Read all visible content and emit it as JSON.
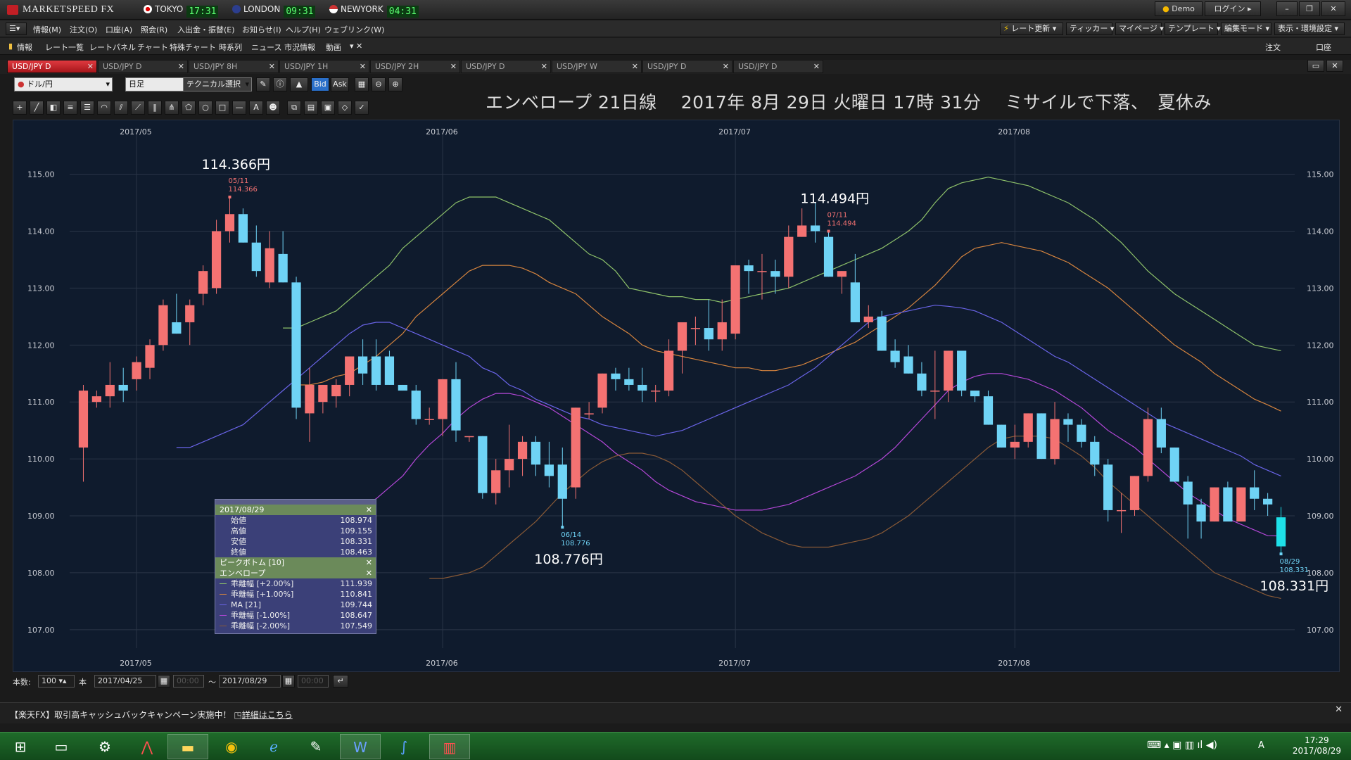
{
  "app": {
    "name": "MARKETSPEED FX"
  },
  "clocks": [
    {
      "city": "TOKYO",
      "time": "17:31"
    },
    {
      "city": "LONDON",
      "time": "09:31"
    },
    {
      "city": "NEWYORK",
      "time": "04:31"
    }
  ],
  "titlebar": {
    "demo_label": "Demo",
    "login_label": "ログイン"
  },
  "menu": [
    "情報(M)",
    "注文(O)",
    "口座(A)",
    "照会(R)",
    "入出金・振替(E)",
    "お知らせ(I)",
    "ヘルプ(H)",
    "ウェブリンク(W)"
  ],
  "menu_right": [
    "レート更新",
    "ティッカー",
    "マイページ",
    "テンプレート",
    "編集モード",
    "表示・環境設定"
  ],
  "quickbar": [
    "情報",
    "レート一覧",
    "レートパネル",
    "チャート",
    "特殊チャート",
    "時系列",
    "ニュース",
    "市況情報",
    "動画"
  ],
  "quickbar_right": [
    "注文",
    "口座"
  ],
  "tabs": [
    {
      "label": "USD/JPY D",
      "active": true
    },
    {
      "label": "USD/JPY D",
      "active": false
    },
    {
      "label": "USD/JPY 8H",
      "active": false
    },
    {
      "label": "USD/JPY 1H",
      "active": false
    },
    {
      "label": "USD/JPY 2H",
      "active": false
    },
    {
      "label": "USD/JPY D",
      "active": false
    },
    {
      "label": "USD/JPY W",
      "active": false
    },
    {
      "label": "USD/JPY D",
      "active": false
    },
    {
      "label": "USD/JPY D",
      "active": false
    }
  ],
  "chartbar": {
    "pair": "ドル/円",
    "period": "日足",
    "technical": "テクニカル選択",
    "bid": "Bid",
    "ask": "Ask"
  },
  "headline": "エンベロープ 21日線　 2017年 8月 29日 火曜日 17時 31分　 ミサイルで下落、　夏休み",
  "chart_data": {
    "type": "candlestick",
    "x_labels": [
      "2017/05",
      "2017/06",
      "2017/07",
      "2017/08"
    ],
    "x_label_index": [
      4,
      27,
      49,
      70
    ],
    "ylim": [
      106.8,
      115.7
    ],
    "yticks": [
      107.0,
      108.0,
      109.0,
      110.0,
      111.0,
      112.0,
      113.0,
      114.0,
      115.0
    ],
    "ohlc": [
      [
        110.2,
        111.3,
        109.6,
        111.2
      ],
      [
        111.0,
        111.2,
        110.9,
        111.1
      ],
      [
        111.1,
        111.7,
        110.9,
        111.3
      ],
      [
        111.3,
        111.6,
        111.0,
        111.2
      ],
      [
        111.4,
        111.8,
        111.2,
        111.7
      ],
      [
        111.6,
        112.1,
        111.4,
        112.0
      ],
      [
        112.0,
        112.8,
        111.9,
        112.7
      ],
      [
        112.4,
        112.9,
        112.2,
        112.2
      ],
      [
        112.4,
        112.8,
        112.0,
        112.7
      ],
      [
        112.9,
        113.4,
        112.7,
        113.3
      ],
      [
        113.0,
        114.2,
        112.9,
        114.0
      ],
      [
        114.0,
        114.6,
        113.8,
        114.3
      ],
      [
        114.3,
        114.4,
        113.8,
        113.8
      ],
      [
        113.8,
        114.1,
        113.2,
        113.3
      ],
      [
        113.1,
        114.0,
        113.0,
        113.7
      ],
      [
        113.6,
        114.0,
        113.1,
        113.1
      ],
      [
        113.1,
        113.2,
        110.7,
        110.9
      ],
      [
        110.8,
        111.6,
        110.3,
        111.3
      ],
      [
        111.0,
        111.3,
        110.8,
        111.3
      ],
      [
        111.1,
        111.4,
        110.9,
        111.3
      ],
      [
        111.3,
        111.8,
        111.1,
        111.8
      ],
      [
        111.8,
        112.1,
        111.3,
        111.5
      ],
      [
        111.8,
        112.1,
        111.2,
        111.3
      ],
      [
        111.8,
        111.9,
        111.3,
        111.3
      ],
      [
        111.3,
        111.3,
        111.2,
        111.2
      ],
      [
        111.2,
        111.3,
        110.6,
        110.7
      ],
      [
        110.7,
        110.9,
        110.6,
        110.7
      ],
      [
        110.7,
        111.4,
        110.4,
        111.4
      ],
      [
        111.4,
        111.7,
        110.3,
        110.5
      ],
      [
        110.4,
        110.4,
        110.3,
        110.4
      ],
      [
        110.4,
        110.4,
        109.3,
        109.4
      ],
      [
        109.4,
        110.0,
        109.2,
        109.8
      ],
      [
        109.8,
        110.6,
        109.5,
        110.0
      ],
      [
        110.0,
        110.4,
        109.7,
        110.3
      ],
      [
        110.3,
        110.4,
        109.7,
        109.9
      ],
      [
        109.9,
        110.3,
        109.5,
        109.7
      ],
      [
        109.9,
        110.2,
        108.8,
        109.3
      ],
      [
        109.5,
        110.9,
        109.3,
        110.9
      ],
      [
        110.8,
        111.0,
        110.7,
        110.8
      ],
      [
        110.9,
        111.5,
        110.8,
        111.5
      ],
      [
        111.5,
        111.6,
        111.2,
        111.4
      ],
      [
        111.4,
        111.6,
        111.2,
        111.3
      ],
      [
        111.3,
        111.6,
        111.0,
        111.2
      ],
      [
        111.2,
        111.3,
        111.0,
        111.2
      ],
      [
        111.2,
        112.1,
        111.1,
        111.9
      ],
      [
        111.9,
        112.3,
        111.5,
        112.4
      ],
      [
        112.3,
        112.5,
        112.0,
        112.3
      ],
      [
        112.3,
        112.8,
        111.9,
        112.1
      ],
      [
        112.1,
        112.8,
        111.9,
        112.4
      ],
      [
        112.2,
        113.4,
        112.1,
        113.4
      ],
      [
        113.4,
        113.5,
        112.9,
        113.3
      ],
      [
        113.3,
        113.6,
        112.8,
        113.3
      ],
      [
        113.3,
        113.5,
        112.9,
        113.2
      ],
      [
        113.2,
        114.1,
        113.0,
        113.9
      ],
      [
        113.9,
        114.4,
        113.9,
        114.1
      ],
      [
        114.1,
        114.5,
        113.8,
        114.0
      ],
      [
        113.9,
        114.0,
        113.2,
        113.2
      ],
      [
        113.2,
        113.3,
        112.9,
        113.3
      ],
      [
        113.1,
        113.6,
        112.4,
        112.4
      ],
      [
        112.4,
        112.7,
        112.3,
        112.5
      ],
      [
        112.5,
        112.6,
        111.9,
        111.9
      ],
      [
        111.9,
        112.1,
        111.6,
        111.7
      ],
      [
        111.8,
        112.0,
        111.5,
        111.5
      ],
      [
        111.5,
        111.7,
        111.1,
        111.2
      ],
      [
        111.2,
        111.9,
        110.7,
        111.2
      ],
      [
        111.2,
        111.9,
        111.0,
        111.9
      ],
      [
        111.9,
        111.8,
        111.1,
        111.2
      ],
      [
        111.2,
        111.2,
        111.0,
        111.1
      ],
      [
        111.1,
        111.2,
        110.6,
        110.6
      ],
      [
        110.6,
        110.6,
        110.2,
        110.2
      ],
      [
        110.2,
        110.6,
        110.0,
        110.3
      ],
      [
        110.3,
        110.8,
        110.2,
        110.8
      ],
      [
        110.8,
        110.8,
        110.0,
        110.0
      ],
      [
        110.0,
        111.0,
        109.9,
        110.7
      ],
      [
        110.7,
        110.8,
        110.3,
        110.6
      ],
      [
        110.6,
        110.7,
        110.2,
        110.3
      ],
      [
        110.3,
        110.4,
        109.7,
        109.9
      ],
      [
        109.9,
        110.0,
        108.9,
        109.1
      ],
      [
        109.1,
        109.4,
        108.7,
        109.1
      ],
      [
        109.1,
        109.7,
        109.0,
        109.7
      ],
      [
        109.7,
        110.9,
        109.6,
        110.7
      ],
      [
        110.7,
        110.9,
        110.1,
        110.2
      ],
      [
        110.2,
        110.2,
        109.6,
        109.6
      ],
      [
        109.6,
        109.7,
        108.6,
        109.2
      ],
      [
        109.2,
        109.3,
        108.6,
        108.9
      ],
      [
        108.9,
        109.5,
        108.9,
        109.5
      ],
      [
        109.5,
        109.6,
        109.0,
        108.9
      ],
      [
        108.9,
        109.5,
        108.9,
        109.5
      ],
      [
        109.5,
        109.8,
        109.1,
        109.3
      ],
      [
        109.3,
        109.4,
        109.0,
        109.2
      ],
      [
        108.974,
        109.155,
        108.331,
        108.463
      ]
    ],
    "envelope": {
      "ma": [
        110.2,
        110.2,
        110.3,
        110.4,
        110.5,
        110.6,
        110.8,
        111.0,
        111.2,
        111.4,
        111.6,
        111.8,
        112.0,
        112.2,
        112.35,
        112.4,
        112.4,
        112.3,
        112.2,
        112.1,
        112.0,
        111.9,
        111.8,
        111.6,
        111.5,
        111.3,
        111.2,
        111.05,
        110.95,
        110.85,
        110.75,
        110.7,
        110.6,
        110.55,
        110.5,
        110.45,
        110.4,
        110.45,
        110.5,
        110.6,
        110.7,
        110.8,
        110.9,
        111.0,
        111.1,
        111.2,
        111.3,
        111.45,
        111.6,
        111.8,
        112.0,
        112.2,
        112.4,
        112.5,
        112.55,
        112.6,
        112.65,
        112.7,
        112.68,
        112.65,
        112.6,
        112.5,
        112.4,
        112.25,
        112.1,
        111.95,
        111.8,
        111.7,
        111.55,
        111.4,
        111.25,
        111.1,
        110.95,
        110.8,
        110.65,
        110.55,
        110.45,
        110.35,
        110.25,
        110.15,
        110.05,
        109.9,
        109.8,
        109.7
      ],
      "upper2": [
        112.3,
        112.3,
        112.4,
        112.5,
        112.6,
        112.8,
        113.0,
        113.2,
        113.4,
        113.7,
        113.9,
        114.1,
        114.3,
        114.5,
        114.6,
        114.6,
        114.6,
        114.5,
        114.4,
        114.3,
        114.2,
        114.0,
        113.8,
        113.6,
        113.5,
        113.3,
        113.0,
        112.95,
        112.9,
        112.85,
        112.85,
        112.8,
        112.8,
        112.75,
        112.8,
        112.85,
        112.9,
        112.95,
        113.0,
        113.1,
        113.2,
        113.3,
        113.4,
        113.5,
        113.6,
        113.7,
        113.85,
        114.0,
        114.2,
        114.5,
        114.75,
        114.85,
        114.9,
        114.95,
        114.9,
        114.85,
        114.8,
        114.7,
        114.6,
        114.5,
        114.35,
        114.2,
        114.0,
        113.8,
        113.55,
        113.3,
        113.1,
        112.9,
        112.75,
        112.6,
        112.45,
        112.3,
        112.15,
        112.0,
        111.95,
        111.9
      ],
      "upper1": [
        111.3,
        111.3,
        111.35,
        111.45,
        111.5,
        111.65,
        111.8,
        112.0,
        112.2,
        112.5,
        112.7,
        112.9,
        113.1,
        113.3,
        113.4,
        113.4,
        113.4,
        113.35,
        113.25,
        113.1,
        113.0,
        112.9,
        112.7,
        112.5,
        112.35,
        112.2,
        112.0,
        111.9,
        111.85,
        111.8,
        111.75,
        111.7,
        111.65,
        111.6,
        111.6,
        111.55,
        111.55,
        111.6,
        111.65,
        111.75,
        111.85,
        111.95,
        112.05,
        112.2,
        112.35,
        112.5,
        112.65,
        112.85,
        113.05,
        113.3,
        113.55,
        113.7,
        113.75,
        113.8,
        113.75,
        113.7,
        113.65,
        113.55,
        113.45,
        113.3,
        113.15,
        113.0,
        112.8,
        112.6,
        112.4,
        112.2,
        112.0,
        111.85,
        111.7,
        111.5,
        111.35,
        111.2,
        111.05,
        110.95,
        110.84
      ],
      "lower1": [
        109.0,
        109.0,
        109.05,
        109.1,
        109.2,
        109.3,
        109.5,
        109.7,
        110.0,
        110.25,
        110.45,
        110.7,
        110.9,
        111.05,
        111.15,
        111.15,
        111.1,
        111.0,
        110.9,
        110.75,
        110.6,
        110.45,
        110.3,
        110.1,
        109.95,
        109.8,
        109.6,
        109.45,
        109.35,
        109.25,
        109.2,
        109.15,
        109.1,
        109.1,
        109.1,
        109.15,
        109.2,
        109.3,
        109.4,
        109.5,
        109.6,
        109.7,
        109.85,
        110.0,
        110.2,
        110.45,
        110.7,
        110.95,
        111.2,
        111.35,
        111.45,
        111.5,
        111.5,
        111.45,
        111.4,
        111.3,
        111.2,
        111.05,
        110.9,
        110.7,
        110.5,
        110.35,
        110.2,
        110.0,
        109.8,
        109.6,
        109.4,
        109.25,
        109.1,
        108.95,
        108.85,
        108.75,
        108.65,
        108.647
      ],
      "lower2": [
        107.9,
        107.9,
        107.95,
        108.0,
        108.1,
        108.3,
        108.5,
        108.7,
        108.9,
        109.15,
        109.4,
        109.6,
        109.8,
        109.95,
        110.05,
        110.1,
        110.1,
        110.05,
        109.95,
        109.8,
        109.6,
        109.4,
        109.2,
        109.0,
        108.85,
        108.7,
        108.6,
        108.5,
        108.45,
        108.45,
        108.45,
        108.5,
        108.55,
        108.6,
        108.7,
        108.85,
        109.0,
        109.2,
        109.4,
        109.6,
        109.8,
        110.0,
        110.2,
        110.35,
        110.4,
        110.4,
        110.4,
        110.35,
        110.2,
        110.05,
        109.85,
        109.6,
        109.4,
        109.2,
        109.0,
        108.8,
        108.6,
        108.4,
        108.2,
        108.0,
        107.9,
        107.8,
        107.7,
        107.6,
        107.549
      ]
    },
    "annotations": [
      {
        "i": 11,
        "date": "05/11",
        "value": "114.366",
        "big": "114.366円",
        "kind": "high"
      },
      {
        "i": 56,
        "date": "07/11",
        "value": "114.494",
        "big": "114.494円",
        "kind": "high"
      },
      {
        "i": 36,
        "date": "06/14",
        "value": "108.776",
        "big": "108.776円",
        "kind": "low"
      },
      {
        "i": 90,
        "date": "08/29",
        "value": "108.331",
        "big": "108.331円",
        "kind": "low"
      }
    ],
    "colors": {
      "up": "#f47272",
      "down": "#6fd3f5",
      "last": "#1ee0e8",
      "ma": "#6a64e8",
      "upper2": "#8ec26a",
      "upper1": "#d6843e",
      "lower1": "#b447d8",
      "lower2": "#8a5a36"
    }
  },
  "datawin": {
    "date": "2017/08/29",
    "ohlc": [
      {
        "label": "始値",
        "value": "108.974"
      },
      {
        "label": "高値",
        "value": "109.155"
      },
      {
        "label": "安値",
        "value": "108.331"
      },
      {
        "label": "終値",
        "value": "108.463"
      }
    ],
    "peak": "ピークボトム [10]",
    "env_title": "エンベロープ",
    "env": [
      {
        "label": "乖離幅 [+2.00%]",
        "value": "111.939",
        "color": "#8ec26a"
      },
      {
        "label": "乖離幅 [+1.00%]",
        "value": "110.841",
        "color": "#d6843e"
      },
      {
        "label": "MA [21]",
        "value": "109.744",
        "color": "#6a64e8"
      },
      {
        "label": "乖離幅 [-1.00%]",
        "value": "108.647",
        "color": "#b447d8"
      },
      {
        "label": "乖離幅 [-2.00%]",
        "value": "107.549",
        "color": "#8a5a36"
      }
    ]
  },
  "rangebar": {
    "count_label": "本数:",
    "count": "100",
    "unit": "本",
    "from": "2017/04/25",
    "to": "2017/08/29",
    "tilde": "～"
  },
  "news": {
    "text": "【楽天FX】取引高キャッシュバックキャンペーン実施中！",
    "link": "詳細はこちら"
  },
  "taskbar": {
    "time": "17:29",
    "date": "2017/08/29",
    "ime": "A"
  }
}
